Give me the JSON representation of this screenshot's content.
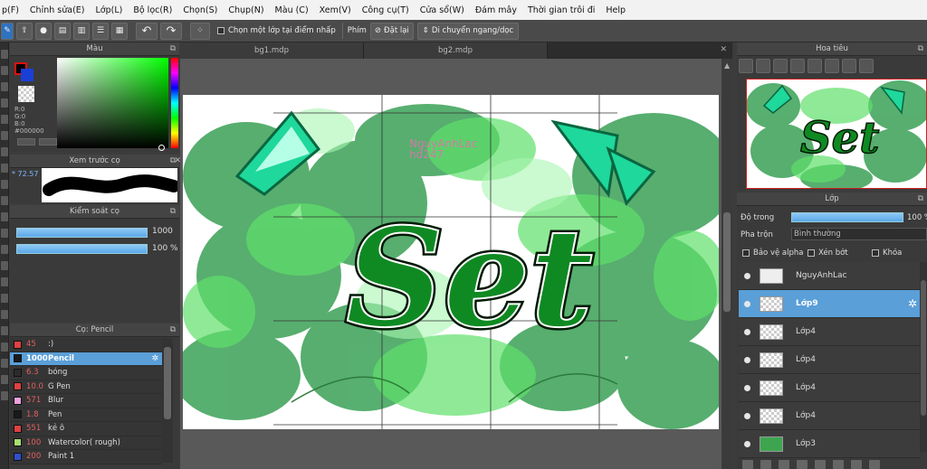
{
  "menu": [
    "p(F)",
    "Chỉnh sửa(E)",
    "Lớp(L)",
    "Bộ lọc(R)",
    "Chọn(S)",
    "Chụp(N)",
    "Màu (C)",
    "Xem(V)",
    "Công cụ(T)",
    "Cửa sổ(W)",
    "Đám mây",
    "Thời gian trôi đi",
    "Help"
  ],
  "toolbar": {
    "select_layer_label": "Chọn một lớp tại điểm nhấp",
    "keys_label": "Phím",
    "reset_label": "Đặt lại",
    "move_label": "Di chuyển ngang/dọc"
  },
  "color_panel": {
    "title": "Màu",
    "r": "R:0",
    "g": "G:0",
    "b": "B:0",
    "hex": "#000000",
    "main_color": "#000000",
    "sub_color": "#1a3fd6",
    "accent_red": "#e01010"
  },
  "preview_panel": {
    "title": "Xem trước cọ",
    "size": "* 72.57"
  },
  "control_panel": {
    "title": "Kiểm soát cọ",
    "size_value": "1000",
    "opacity_value": "100 %"
  },
  "brush_panel": {
    "title": "Cọ: Pencil",
    "brushes": [
      {
        "size": "45",
        "name": ":)",
        "color": "#e04040"
      },
      {
        "size": "1000",
        "name": "Pencil",
        "color": "#1a1a1a",
        "selected": true
      },
      {
        "size": "6.3",
        "name": "bóng",
        "color": "#2b2b2b"
      },
      {
        "size": "10.0",
        "name": "G Pen",
        "color": "#e04040"
      },
      {
        "size": "571",
        "name": "Blur",
        "color": "#f0a0e0"
      },
      {
        "size": "1.8",
        "name": "Pen",
        "color": "#1a1a1a"
      },
      {
        "size": "551",
        "name": "kẻ ô",
        "color": "#e04040"
      },
      {
        "size": "100",
        "name": "Watercolor( rough)",
        "color": "#a8e070"
      },
      {
        "size": "200",
        "name": "Paint 1",
        "color": "#3050d0"
      }
    ]
  },
  "tabs": [
    "bg1.mdp",
    "bg2.mdp"
  ],
  "canvas": {
    "title_text": "Set",
    "watermark": "NguyAnhLac",
    "watermark2": "hd247"
  },
  "navigator": {
    "title": "Hoa tiêu",
    "title_text": "Set"
  },
  "layer_panel": {
    "title": "Lớp",
    "opacity_label": "Độ trong",
    "opacity_value": "100 %",
    "blend_label": "Pha trộn",
    "blend_value": "Bình thường",
    "protect_alpha": "Bảo vệ alpha",
    "clipping": "Xén bớt",
    "lock": "Khóa",
    "layers": [
      {
        "name": "NguyAnhLac",
        "thumb": "text"
      },
      {
        "name": "Lớp9",
        "selected": true,
        "thumb": "empty"
      },
      {
        "name": "Lớp4",
        "thumb": "set"
      },
      {
        "name": "Lớp4",
        "thumb": "dots"
      },
      {
        "name": "Lớp4",
        "thumb": "empty"
      },
      {
        "name": "Lớp4",
        "thumb": "empty"
      },
      {
        "name": "Lớp3",
        "thumb": "green"
      }
    ]
  }
}
